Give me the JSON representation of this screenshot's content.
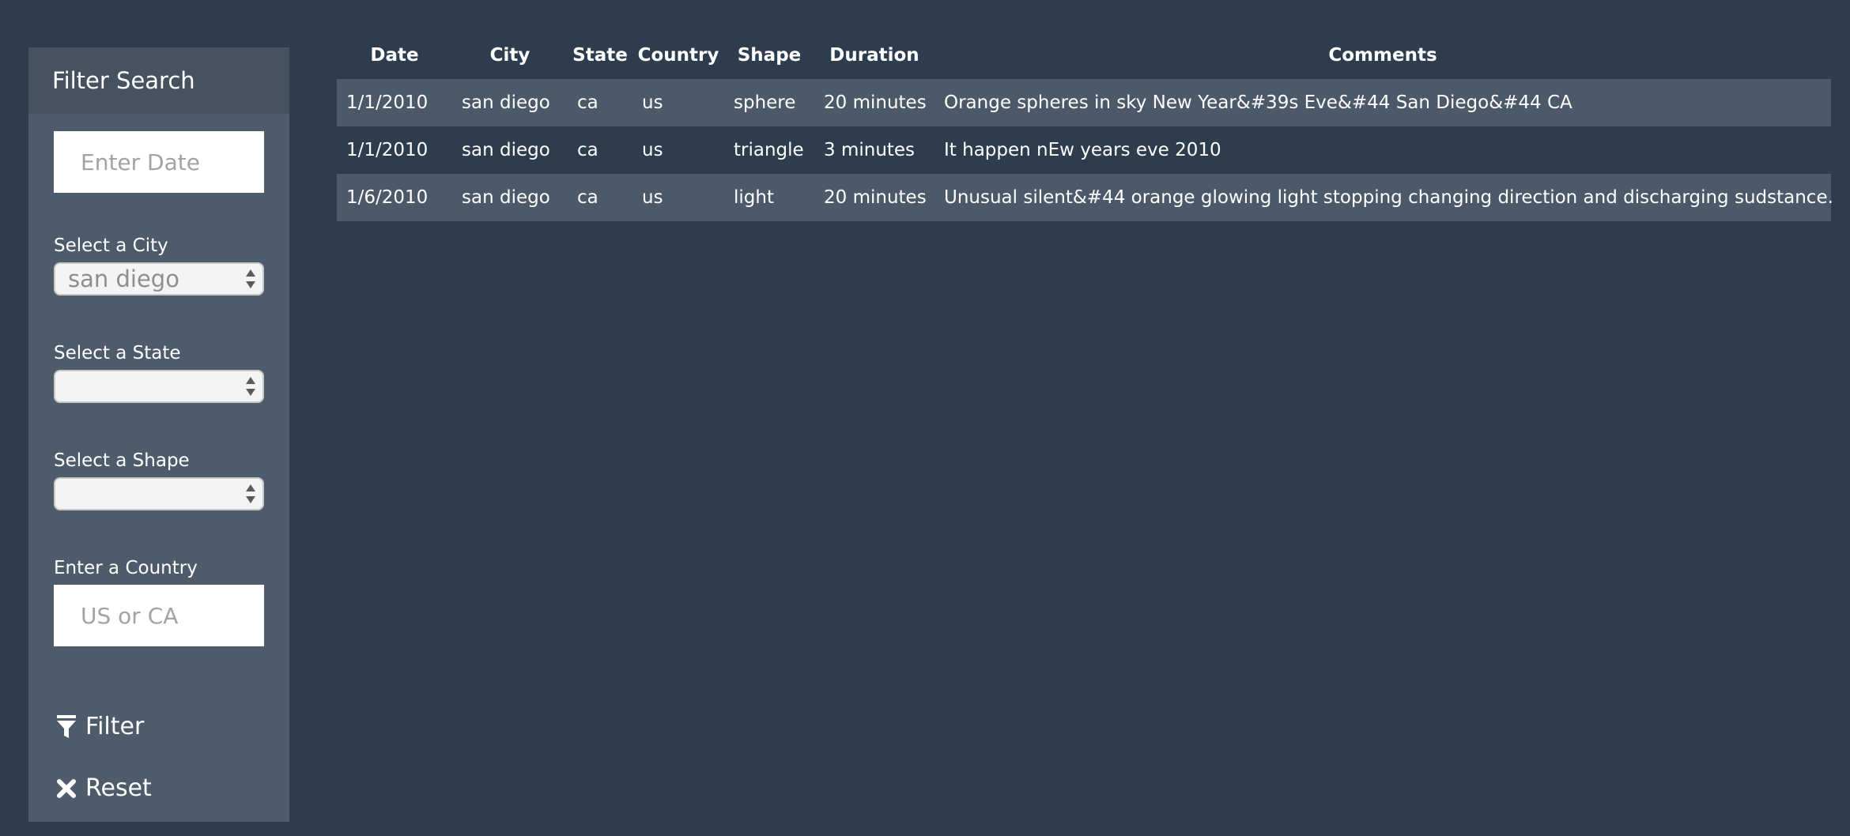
{
  "sidebar": {
    "title": "Filter Search",
    "date_input": {
      "placeholder": "Enter Date",
      "value": ""
    },
    "city": {
      "label": "Select a City",
      "selected": "san diego"
    },
    "state": {
      "label": "Select a State",
      "selected": ""
    },
    "shape": {
      "label": "Select a Shape",
      "selected": ""
    },
    "country": {
      "label": "Enter a Country",
      "placeholder": "US or CA",
      "value": ""
    },
    "filter_button": {
      "label": "Filter",
      "icon": "filter-icon"
    },
    "reset_button": {
      "label": "Reset",
      "icon": "close-icon"
    }
  },
  "table": {
    "headers": {
      "date": "Date",
      "city": "City",
      "state": "State",
      "country": "Country",
      "shape": "Shape",
      "duration": "Duration",
      "comments": "Comments"
    },
    "rows": [
      {
        "date": "1/1/2010",
        "city": "san diego",
        "state": "ca",
        "country": "us",
        "shape": "sphere",
        "duration": "20 minutes",
        "comments": "Orange spheres in sky New Year&#39s Eve&#44 San Diego&#44 CA"
      },
      {
        "date": "1/1/2010",
        "city": "san diego",
        "state": "ca",
        "country": "us",
        "shape": "triangle",
        "duration": "3 minutes",
        "comments": "It happen nEw years eve 2010"
      },
      {
        "date": "1/6/2010",
        "city": "san diego",
        "state": "ca",
        "country": "us",
        "shape": "light",
        "duration": "20 minutes",
        "comments": "Unusual silent&#44 orange glowing light stopping changing direction and discharging sudstance."
      }
    ]
  },
  "colors": {
    "page_background": "#2e3d4e",
    "sidebar_background": "#4e5b6a",
    "sidebar_header": "#46525f",
    "shaded_row": "#4c5969"
  }
}
